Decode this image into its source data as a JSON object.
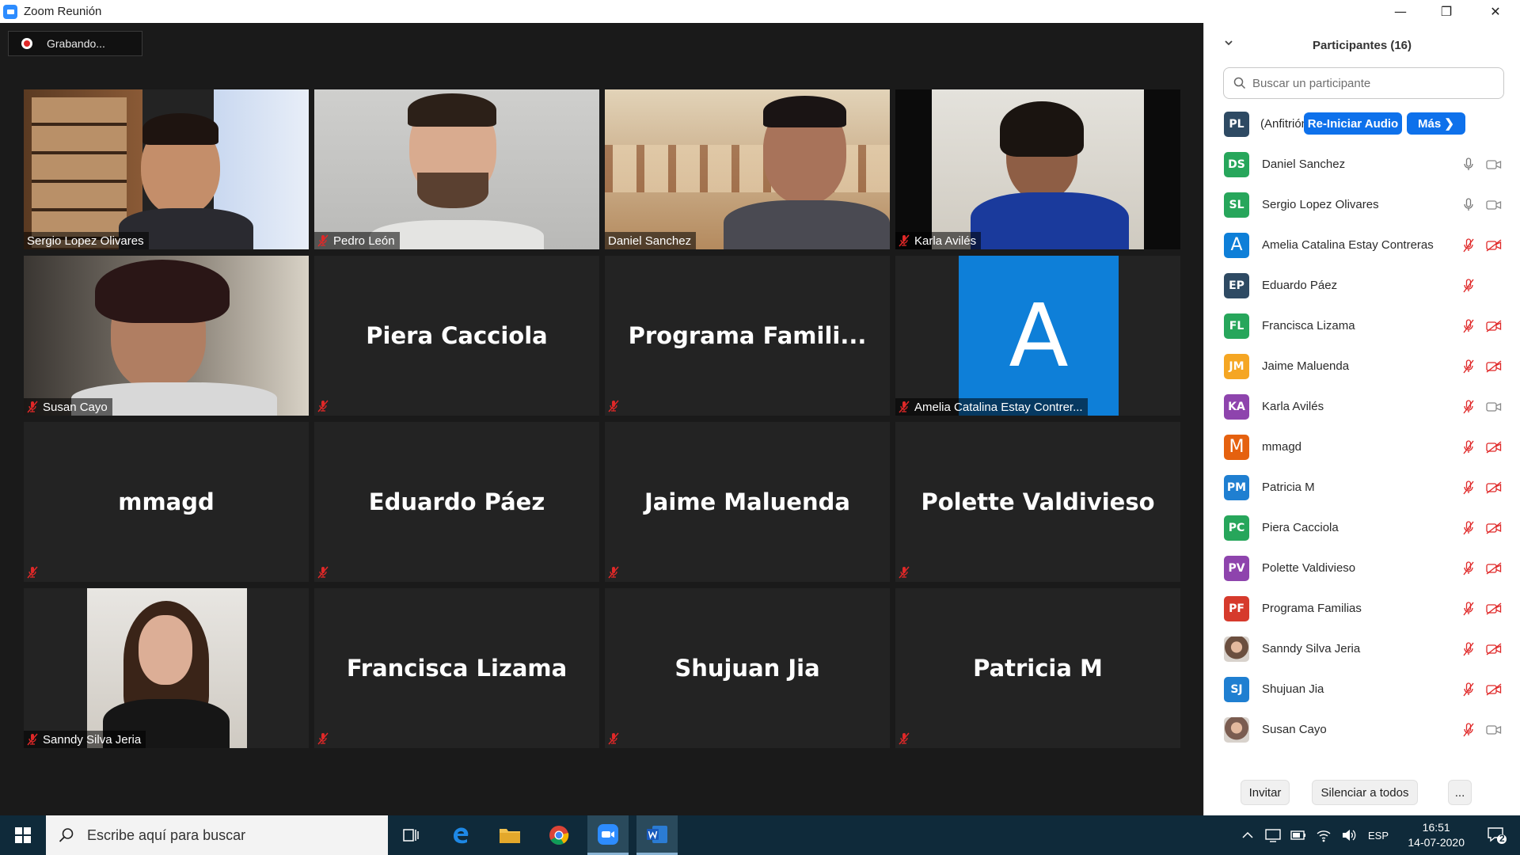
{
  "window": {
    "title": "Zoom Reunión"
  },
  "recording": {
    "label": "Grabando..."
  },
  "tiles": [
    {
      "name": "Sergio Lopez Olivares",
      "type": "video"
    },
    {
      "name": "Pedro León",
      "type": "video"
    },
    {
      "name": "Daniel Sanchez",
      "type": "video",
      "active_speaker": true
    },
    {
      "name": "Karla Avilés",
      "type": "video"
    },
    {
      "name": "Susan Cayo",
      "type": "video"
    },
    {
      "name": "Piera Cacciola",
      "type": "name"
    },
    {
      "name": "Programa  Famili...",
      "type": "name"
    },
    {
      "name": "Amelia Catalina Estay Contrer...",
      "type": "avatar",
      "avatar_letter": "A"
    },
    {
      "name": "mmagd",
      "type": "name"
    },
    {
      "name": "Eduardo Páez",
      "type": "name"
    },
    {
      "name": "Jaime Maluenda",
      "type": "name"
    },
    {
      "name": "Polette Valdivieso",
      "type": "name"
    },
    {
      "name": "Sanndy Silva Jeria",
      "type": "video"
    },
    {
      "name": "Francisca Lizama",
      "type": "name"
    },
    {
      "name": "Shujuan Jia",
      "type": "name"
    },
    {
      "name": "Patricia M",
      "type": "name"
    }
  ],
  "participants_panel": {
    "title": "Participantes (16)",
    "search_placeholder": "Buscar un participante",
    "host": {
      "initials": "PL",
      "label": "(Anfitrión,",
      "reaudio_button": "Re-Iniciar Audio",
      "more_button": "Más ❯",
      "color": "#2e4a63"
    },
    "participants": [
      {
        "initials": "DS",
        "name": "Daniel Sanchez",
        "color": "#27a65b",
        "mic": "on",
        "video": "on"
      },
      {
        "initials": "SL",
        "name": "Sergio Lopez Olivares",
        "color": "#27a65b",
        "mic": "on",
        "video": "on"
      },
      {
        "initials": "A",
        "name": "Amelia Catalina Estay Contreras",
        "color": "#0e7fd8",
        "mic": "off",
        "video": "off"
      },
      {
        "initials": "EP",
        "name": "Eduardo Páez",
        "color": "#2e4a63",
        "mic": "off",
        "video": "none"
      },
      {
        "initials": "FL",
        "name": "Francisca Lizama",
        "color": "#27a65b",
        "mic": "off",
        "video": "off"
      },
      {
        "initials": "JM",
        "name": "Jaime Maluenda",
        "color": "#f5a623",
        "mic": "off",
        "video": "off"
      },
      {
        "initials": "KA",
        "name": "Karla Avilés",
        "color": "#8e44ad",
        "mic": "off",
        "video": "on"
      },
      {
        "initials": "M",
        "name": "mmagd",
        "color": "#e5610f",
        "mic": "off",
        "video": "off"
      },
      {
        "initials": "PM",
        "name": "Patricia M",
        "color": "#1f7fd1",
        "mic": "off",
        "video": "off"
      },
      {
        "initials": "PC",
        "name": "Piera Cacciola",
        "color": "#27a65b",
        "mic": "off",
        "video": "off"
      },
      {
        "initials": "PV",
        "name": "Polette Valdivieso",
        "color": "#8e44ad",
        "mic": "off",
        "video": "off"
      },
      {
        "initials": "PF",
        "name": "Programa Familias",
        "color": "#d63a2c",
        "mic": "off",
        "video": "off"
      },
      {
        "initials": "",
        "name": "Sanndy Silva Jeria",
        "color": "#6b4f3f",
        "mic": "off",
        "video": "off",
        "photo": true
      },
      {
        "initials": "SJ",
        "name": "Shujuan Jia",
        "color": "#1f7fd1",
        "mic": "off",
        "video": "off"
      },
      {
        "initials": "",
        "name": "Susan Cayo",
        "color": "#7a5c50",
        "mic": "off",
        "video": "on",
        "photo": true
      }
    ],
    "footer": {
      "invite": "Invitar",
      "mute_all": "Silenciar a todos",
      "more": "..."
    }
  },
  "taskbar": {
    "search_placeholder": "Escribe aquí para buscar",
    "language": "ESP",
    "time": "16:51",
    "date": "14-07-2020",
    "notifications": "2"
  },
  "colors": {
    "zoom_blue": "#0e71eb",
    "mute_red": "#e02828",
    "active_speaker": "#d6e27a",
    "video_icon": "#888888"
  }
}
